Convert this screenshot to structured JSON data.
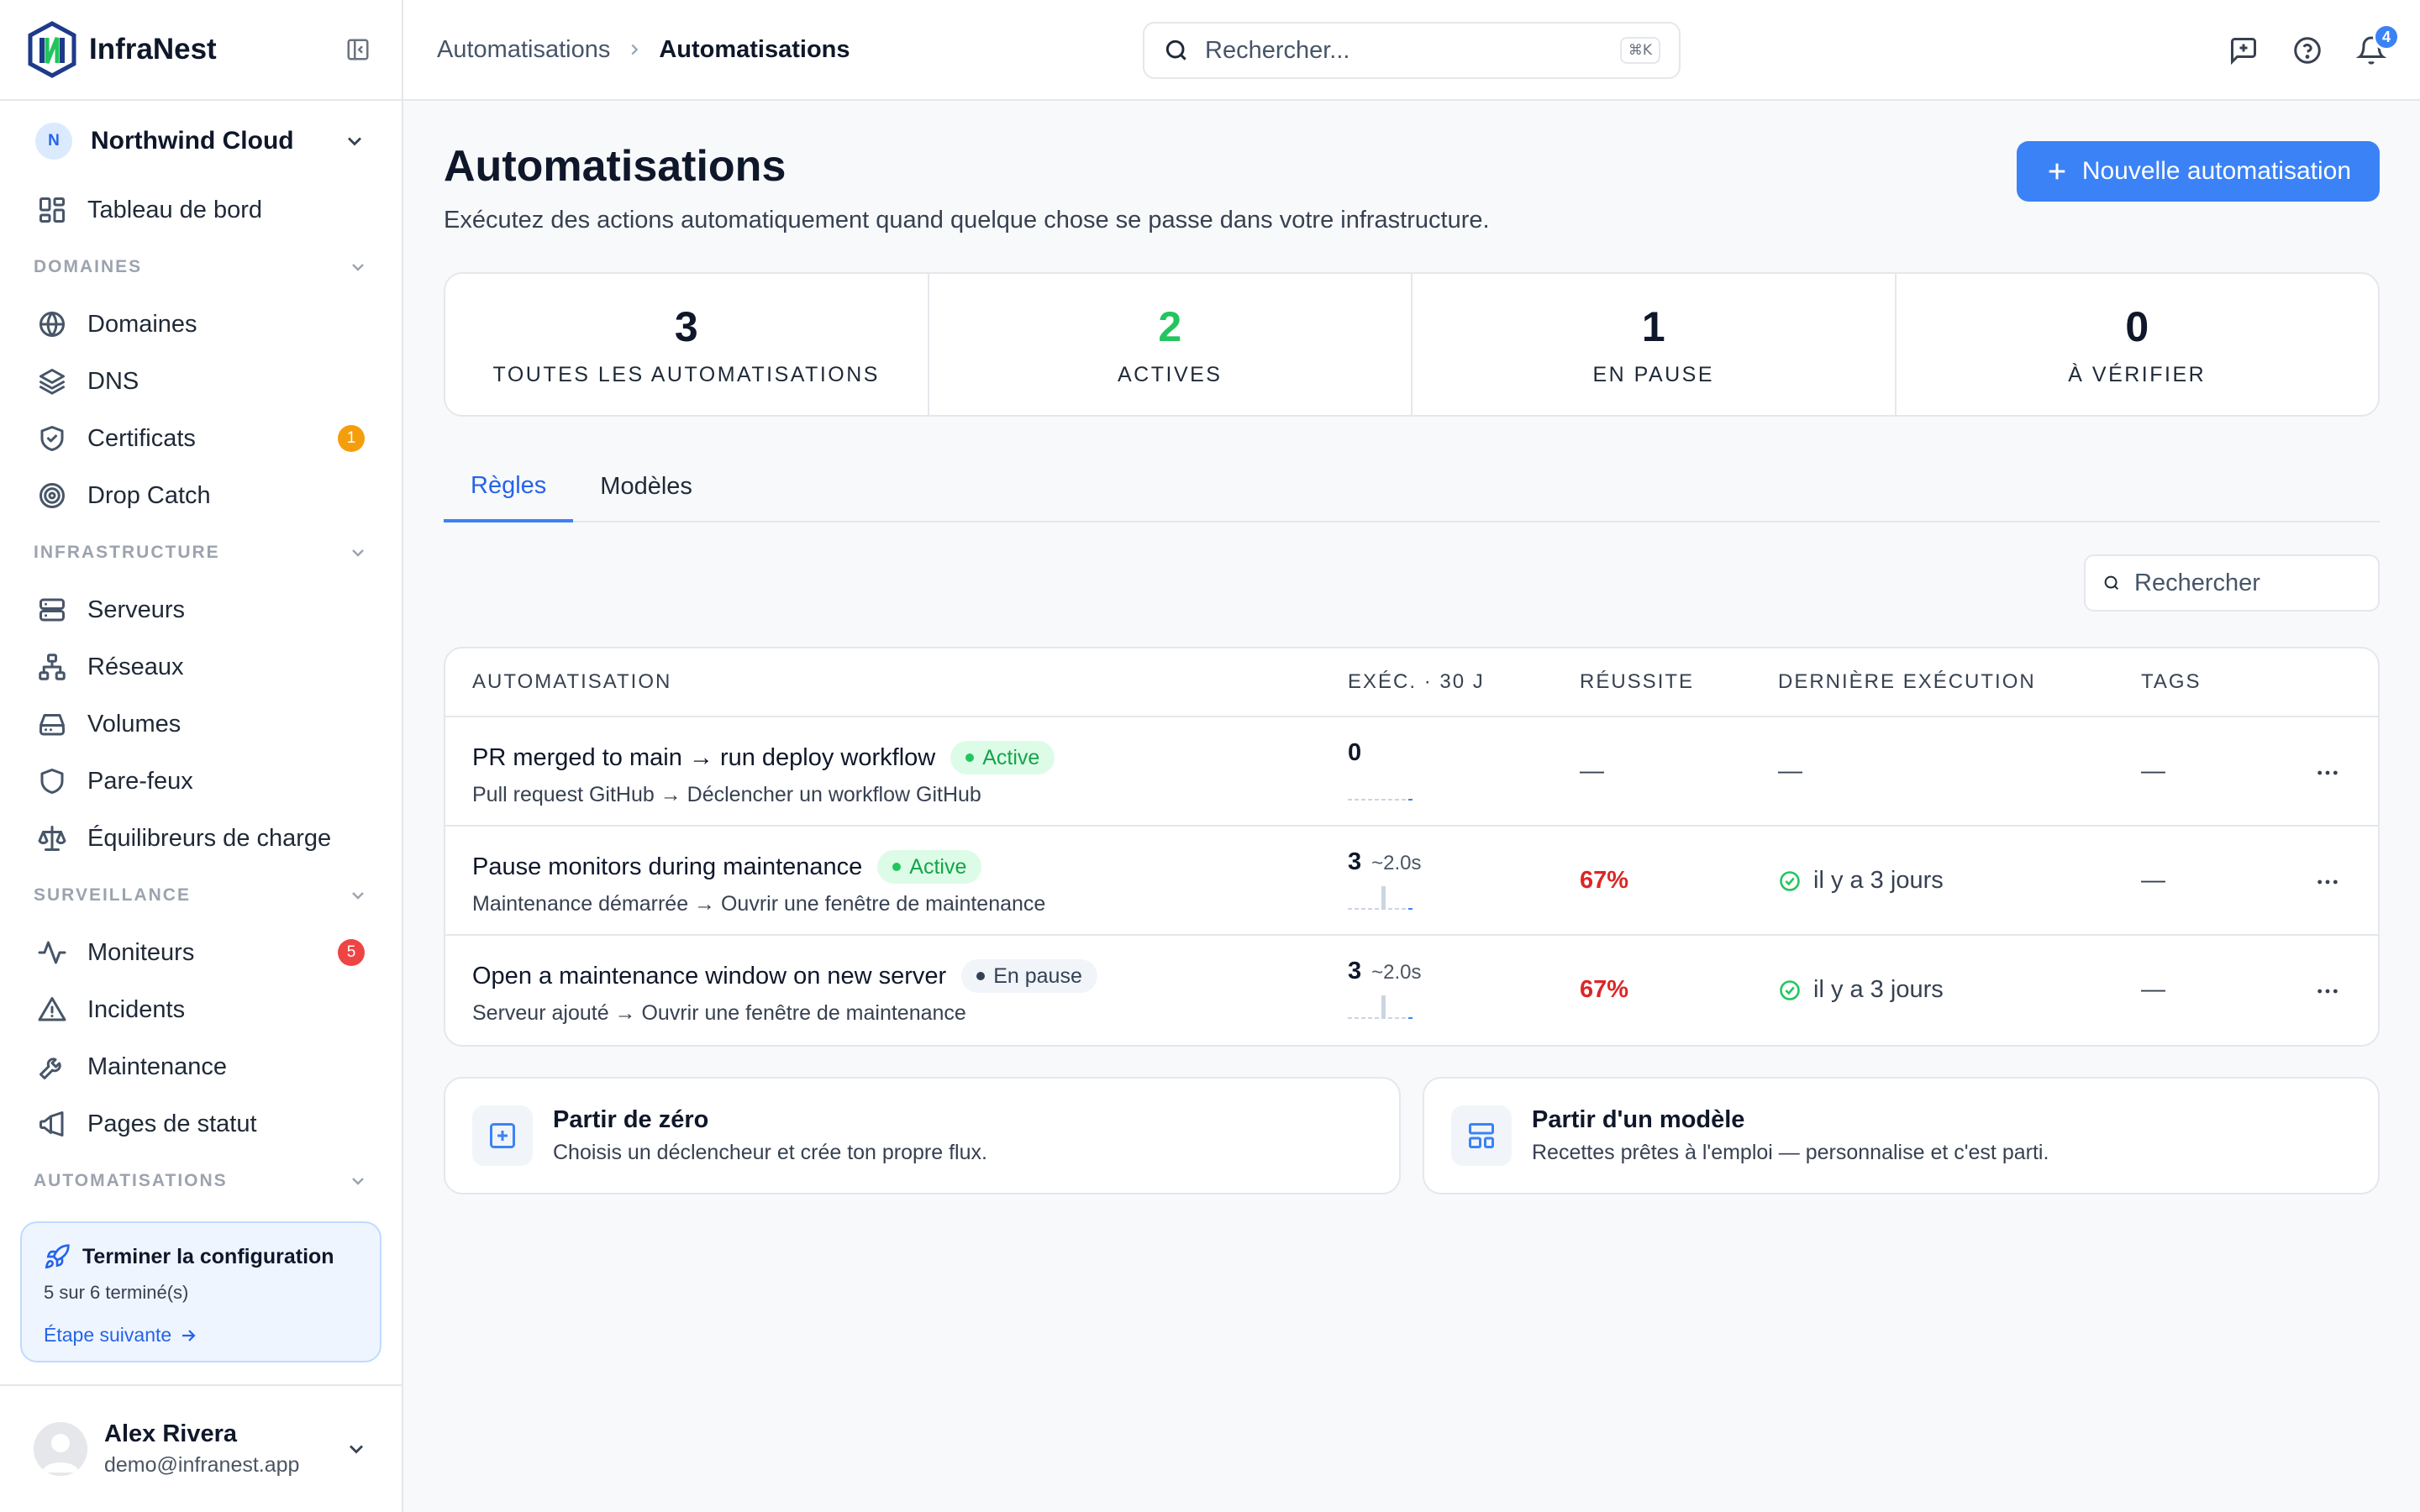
{
  "brand": {
    "name": "InfraNest"
  },
  "org": {
    "initial": "N",
    "name": "Northwind Cloud"
  },
  "nav": {
    "dashboard": "Tableau de bord",
    "sections": [
      {
        "label": "DOMAINES",
        "items": [
          {
            "label": "Domaines",
            "icon": "globe-icon"
          },
          {
            "label": "DNS",
            "icon": "layers-icon"
          },
          {
            "label": "Certificats",
            "icon": "shield-check-icon",
            "badge": "1",
            "badge_color": "#f59e0b"
          },
          {
            "label": "Drop Catch",
            "icon": "target-icon"
          }
        ]
      },
      {
        "label": "INFRASTRUCTURE",
        "items": [
          {
            "label": "Serveurs",
            "icon": "server-icon"
          },
          {
            "label": "Réseaux",
            "icon": "network-icon"
          },
          {
            "label": "Volumes",
            "icon": "hard-drive-icon"
          },
          {
            "label": "Pare-feux",
            "icon": "shield-icon"
          },
          {
            "label": "Équilibreurs de charge",
            "icon": "scale-icon"
          }
        ]
      },
      {
        "label": "SURVEILLANCE",
        "items": [
          {
            "label": "Moniteurs",
            "icon": "activity-icon",
            "badge": "5",
            "badge_color": "#ef4444"
          },
          {
            "label": "Incidents",
            "icon": "alert-triangle-icon"
          },
          {
            "label": "Maintenance",
            "icon": "wrench-icon"
          },
          {
            "label": "Pages de statut",
            "icon": "megaphone-icon"
          }
        ]
      },
      {
        "label": "AUTOMATISATIONS",
        "items": []
      }
    ]
  },
  "setup": {
    "title": "Terminer la configuration",
    "progress": "5 sur 6 terminé(s)",
    "next": "Étape suivante"
  },
  "user": {
    "name": "Alex Rivera",
    "email": "demo@infranest.app"
  },
  "topbar": {
    "crumb_parent": "Automatisations",
    "crumb_current": "Automatisations",
    "search_placeholder": "Rechercher...",
    "search_shortcut": "⌘K",
    "notif_count": "4"
  },
  "page": {
    "title": "Automatisations",
    "subtitle": "Exécutez des actions automatiquement quand quelque chose se passe dans votre infrastructure.",
    "new_button": "Nouvelle automatisation"
  },
  "stats": [
    {
      "value": "3",
      "label": "TOUTES LES AUTOMATISATIONS",
      "color": "#0f172a"
    },
    {
      "value": "2",
      "label": "ACTIVES",
      "color": "#22c55e"
    },
    {
      "value": "1",
      "label": "EN PAUSE",
      "color": "#0f172a"
    },
    {
      "value": "0",
      "label": "À VÉRIFIER",
      "color": "#0f172a"
    }
  ],
  "tabs": [
    {
      "label": "Règles",
      "active": true
    },
    {
      "label": "Modèles",
      "active": false
    }
  ],
  "filter": {
    "placeholder": "Rechercher"
  },
  "table": {
    "headers": {
      "automation": "AUTOMATISATION",
      "exec": "EXÉC. · 30 J",
      "success": "RÉUSSITE",
      "last": "DERNIÈRE EXÉCUTION",
      "tags": "TAGS"
    },
    "rows": [
      {
        "title": "PR merged to main → run deploy workflow",
        "status": "Active",
        "status_kind": "active",
        "subtitle": "Pull request GitHub → Déclencher un workflow GitHub",
        "exec": "0",
        "duration": "",
        "spark": [
          0,
          0,
          0,
          0,
          0,
          0,
          0,
          0,
          0,
          0
        ],
        "success": "—",
        "last": "—",
        "last_ok": false,
        "tags": "—"
      },
      {
        "title": "Pause monitors during maintenance",
        "status": "Active",
        "status_kind": "active",
        "subtitle": "Maintenance démarrée → Ouvrir une fenêtre de maintenance",
        "exec": "3",
        "duration": "~2.0s",
        "spark": [
          0,
          0,
          0,
          0,
          0,
          3,
          0,
          0,
          0,
          0
        ],
        "success": "67%",
        "last": "il y a 3 jours",
        "last_ok": true,
        "tags": "—"
      },
      {
        "title": "Open a maintenance window on new server",
        "status": "En pause",
        "status_kind": "paused",
        "subtitle": "Serveur ajouté → Ouvrir une fenêtre de maintenance",
        "exec": "3",
        "duration": "~2.0s",
        "spark": [
          0,
          0,
          0,
          0,
          0,
          3,
          0,
          0,
          0,
          0
        ],
        "success": "67%",
        "last": "il y a 3 jours",
        "last_ok": true,
        "tags": "—"
      }
    ]
  },
  "starters": [
    {
      "title": "Partir de zéro",
      "desc": "Choisis un déclencheur et crée ton propre flux.",
      "icon": "plus-square-icon"
    },
    {
      "title": "Partir d'un modèle",
      "desc": "Recettes prêtes à l'emploi — personnalise et c'est parti.",
      "icon": "template-icon"
    }
  ],
  "colors": {
    "accent": "#3b82f6",
    "active_bg": "#dcfce7",
    "active_fg": "#16a34a",
    "paused_bg": "#f1f5f9",
    "paused_fg": "#334155",
    "danger": "#dc2626",
    "success": "#22c55e"
  }
}
